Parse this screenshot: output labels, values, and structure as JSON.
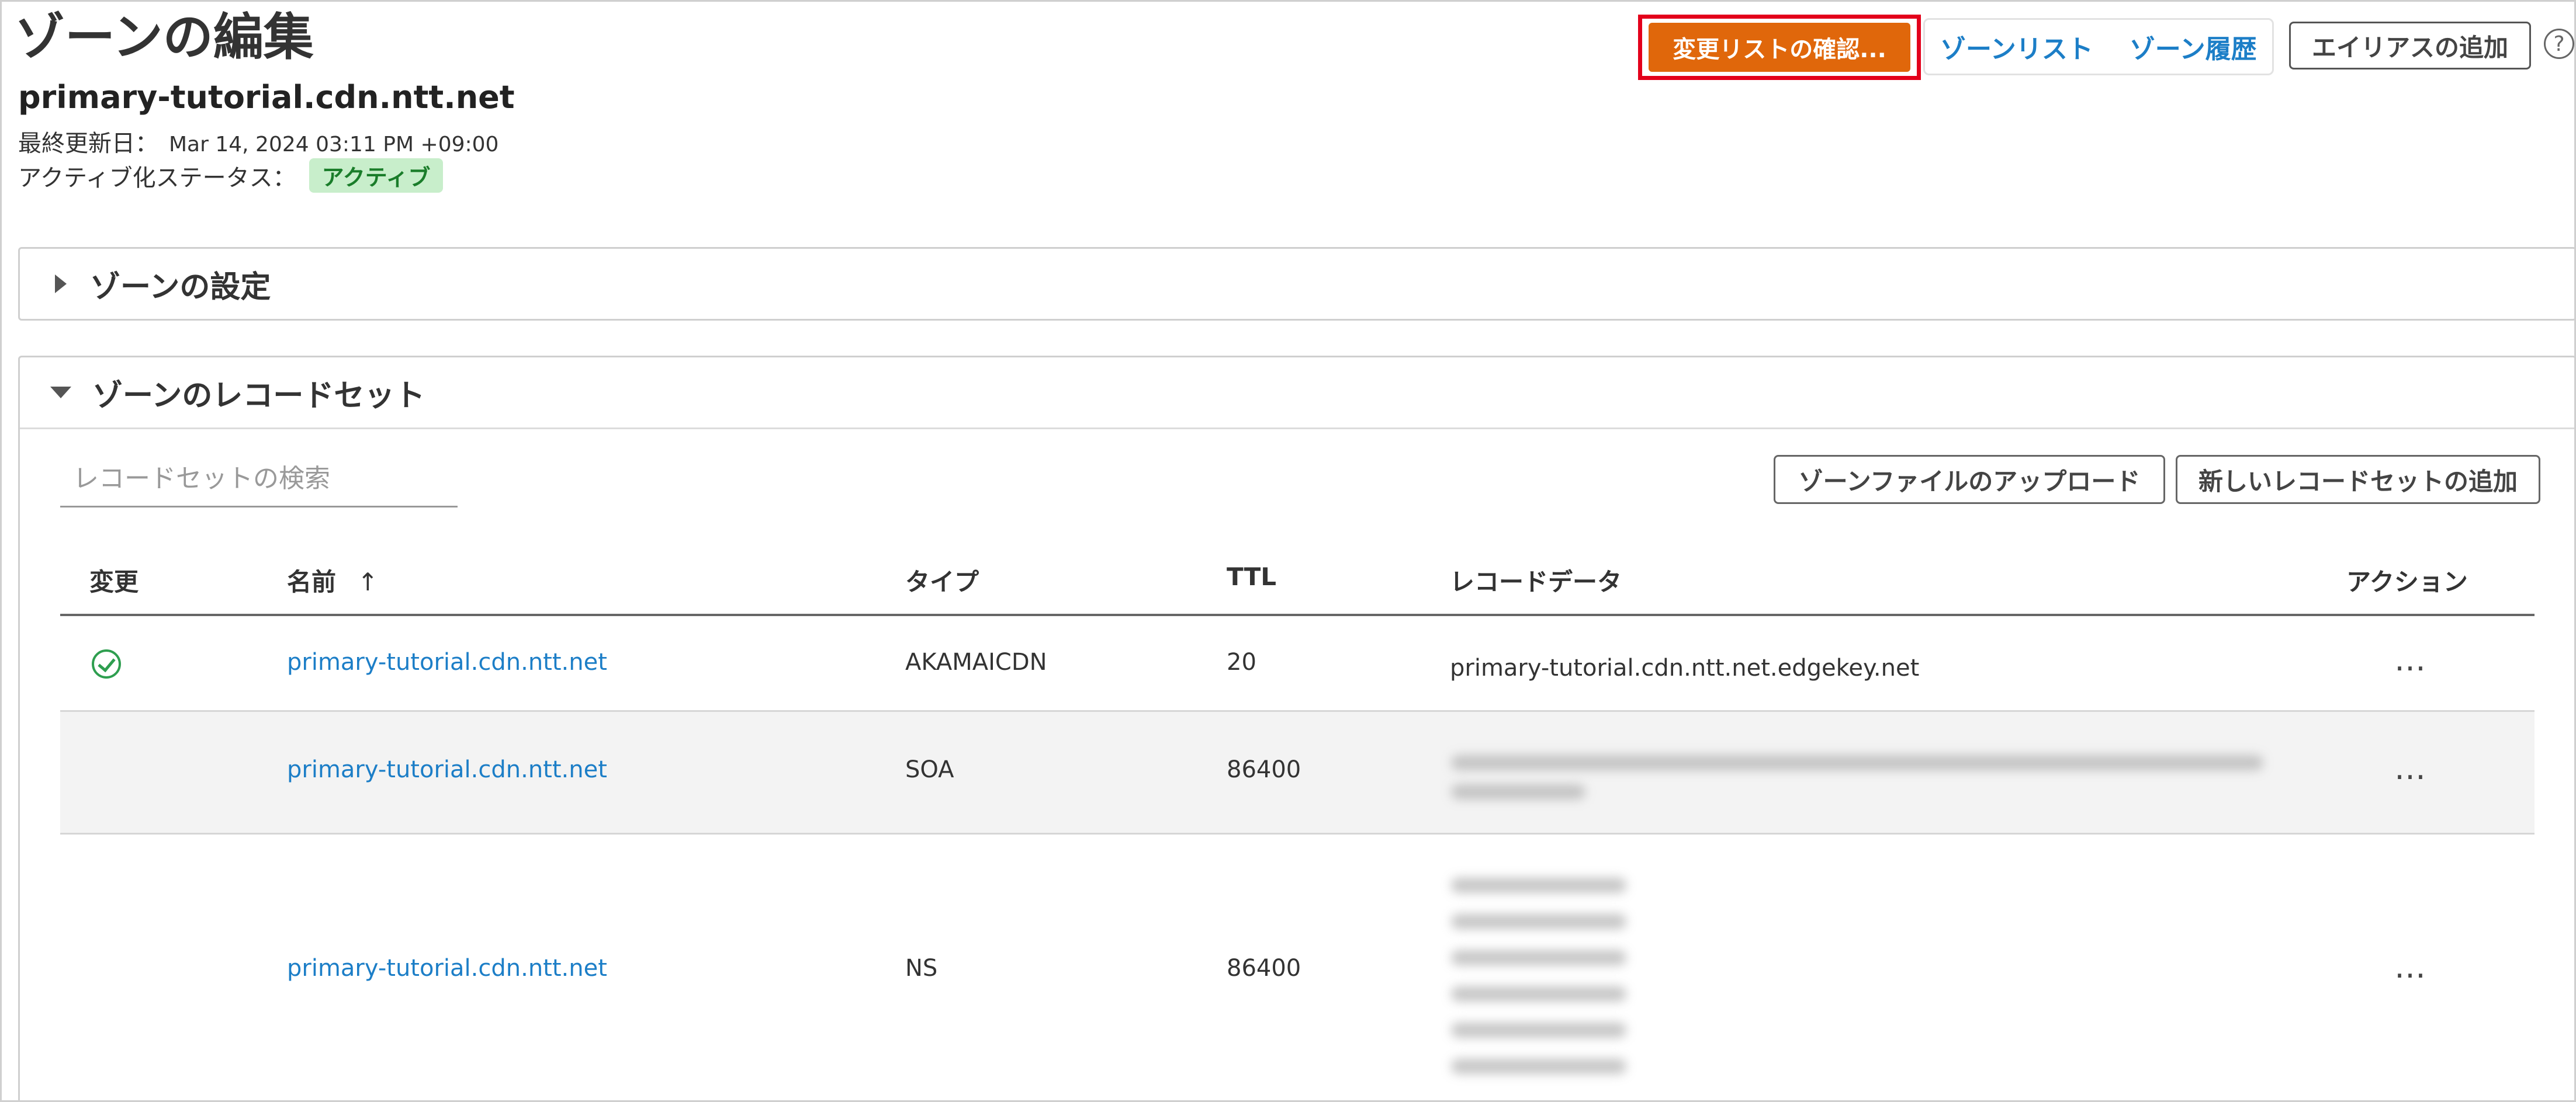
{
  "header": {
    "title": "ゾーンの編集",
    "zone_name": "primary-tutorial.cdn.ntt.net",
    "last_updated_label": "最終更新日：",
    "last_updated_value": "Mar 14, 2024 03:11 PM +09:00",
    "activation_status_label": "アクティブ化ステータス：",
    "activation_status_value": "アクティブ"
  },
  "toolbar": {
    "review_changes_label": "変更リストの確認...",
    "zone_list_label": "ゾーンリスト",
    "zone_history_label": "ゾーン履歴",
    "add_alias_label": "エイリアスの追加",
    "help_symbol": "?"
  },
  "panels": {
    "settings_title": "ゾーンの設定",
    "recordsets_title": "ゾーンのレコードセット"
  },
  "recordsets": {
    "search_placeholder": "レコードセットの検索",
    "upload_zone_file_label": "ゾーンファイルのアップロード",
    "add_recordset_label": "新しいレコードセットの追加"
  },
  "table": {
    "columns": {
      "change": "変更",
      "name": "名前",
      "sort_indicator": "↑",
      "type": "タイプ",
      "ttl": "TTL",
      "record_data": "レコードデータ",
      "actions": "アクション"
    },
    "rows": [
      {
        "changed": true,
        "name": "primary-tutorial.cdn.ntt.net",
        "type": "AKAMAICDN",
        "ttl": "20",
        "record_data": "primary-tutorial.cdn.ntt.net.edgekey.net",
        "action": "…"
      },
      {
        "changed": false,
        "name": "primary-tutorial.cdn.ntt.net",
        "type": "SOA",
        "ttl": "86400",
        "record_data": "",
        "action": "…"
      },
      {
        "changed": false,
        "name": "primary-tutorial.cdn.ntt.net",
        "type": "NS",
        "ttl": "86400",
        "record_data": "",
        "action": "…"
      }
    ]
  },
  "colors": {
    "accent_orange": "#e0670b",
    "highlight_red": "#e3001b",
    "link_blue": "#1c7ec7",
    "status_green_bg": "#c8eecb",
    "status_green_text": "#1a7d2a",
    "row_alt_bg": "#f3f3f3"
  }
}
